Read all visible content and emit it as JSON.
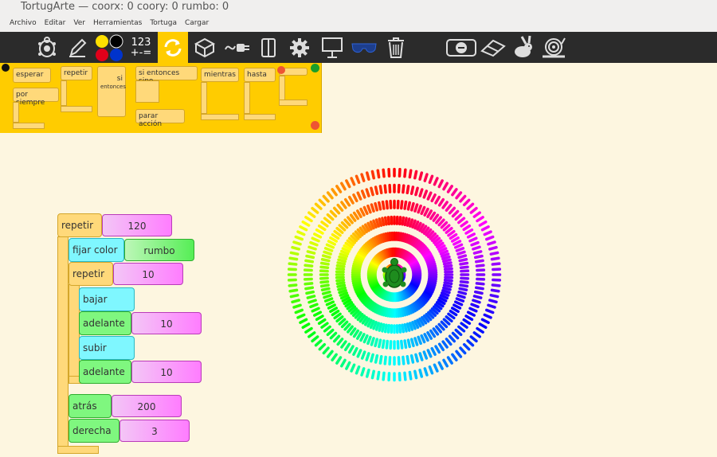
{
  "window": {
    "title": "TortugArte — coorx: 0 coory: 0 rumbo: 0"
  },
  "menu": [
    "Archivo",
    "Editar",
    "Ver",
    "Herramientas",
    "Tortuga",
    "Cargar"
  ],
  "toolbar": {
    "numbers_label_top": "123",
    "numbers_label_bottom": "+-=",
    "colors": {
      "yellow": "#ffe000",
      "black": "#000000",
      "red": "#e0001a",
      "blue": "#0033cc",
      "active_bg": "#ffcc00"
    },
    "icons": [
      "turtle-icon",
      "pencil-icon",
      "colors-icon",
      "numbers-icon",
      "flow-icon",
      "blocks-icon",
      "sensors-icon",
      "media-icon",
      "settings-icon",
      "presentation-icon",
      "glasses-icon",
      "trash-icon",
      "stop-icon",
      "eraser-icon",
      "rabbit-icon",
      "snail-icon"
    ]
  },
  "palette": {
    "blocks": [
      "esperar",
      "por siempre",
      "repetir",
      "si",
      "entonces",
      "si entonces sino",
      "parar acción",
      "mientras",
      "hasta"
    ]
  },
  "program": {
    "repeat_outer": {
      "label": "repetir",
      "value": "120"
    },
    "set_color": {
      "label": "fijar color",
      "value": "rumbo"
    },
    "repeat_inner": {
      "label": "repetir",
      "value": "10"
    },
    "pen_down": "bajar pluma",
    "forward1": {
      "label": "adelante",
      "value": "10"
    },
    "pen_up": "subir pluma",
    "forward2": {
      "label": "adelante",
      "value": "10"
    },
    "back": {
      "label": "atrás",
      "value": "200"
    },
    "right": {
      "label": "derecha",
      "value": "3"
    }
  },
  "drawing": {
    "rays": 120,
    "dashes_per_ray": 7,
    "dash_length": 10,
    "gap_length": 10
  }
}
